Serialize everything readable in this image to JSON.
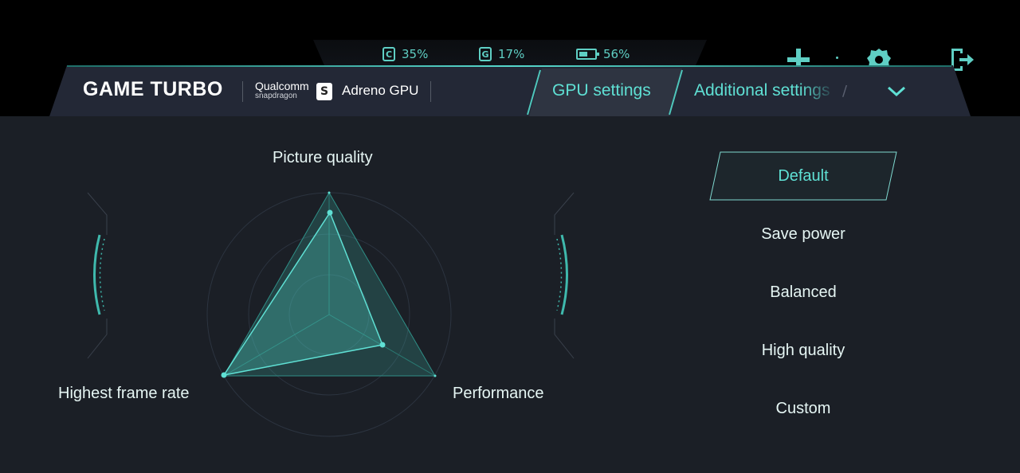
{
  "status": {
    "cpu": {
      "letter": "C",
      "value": "35%"
    },
    "gpu": {
      "letter": "G",
      "value": "17%"
    },
    "battery": {
      "value": "56%"
    }
  },
  "top_icons": [
    "plus-icon",
    "settings-gear-icon",
    "exit-icon"
  ],
  "header": {
    "title": "GAME TURBO",
    "brand_line1": "Qualcomm",
    "brand_line2": "snapdragon",
    "gpu_label": "Adreno GPU",
    "tabs": [
      {
        "label": "GPU settings",
        "active": true
      },
      {
        "label": "Additional settings",
        "active": false
      }
    ],
    "tab_divider": "/"
  },
  "radar": {
    "axes": {
      "top": "Picture quality",
      "left": "Highest frame rate",
      "right": "Performance"
    },
    "accent": "#4fd6c8"
  },
  "presets": {
    "items": [
      {
        "label": "Default",
        "selected": true
      },
      {
        "label": "Save power",
        "selected": false
      },
      {
        "label": "Balanced",
        "selected": false
      },
      {
        "label": "High quality",
        "selected": false
      },
      {
        "label": "Custom",
        "selected": false
      }
    ]
  },
  "colors": {
    "accent": "#5fe0d4",
    "background": "#1b1f26",
    "header": "#232836"
  }
}
